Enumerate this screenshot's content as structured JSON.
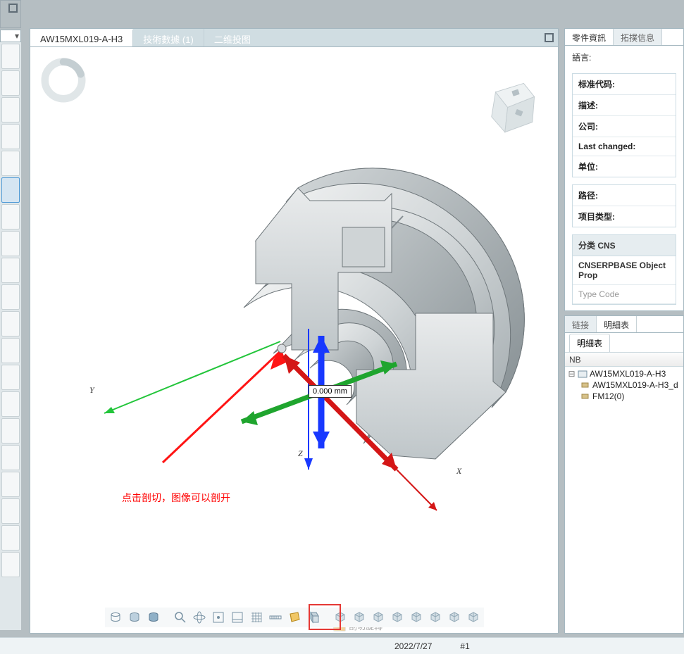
{
  "main": {
    "tabs": [
      {
        "label": "AW15MXL019-A-H3",
        "active": true
      },
      {
        "label": "技術數據 (1)",
        "active": false
      },
      {
        "label": "二维投图",
        "active": false
      }
    ],
    "measurement": "0.000 mm",
    "axes": {
      "x": "X",
      "y": "Y",
      "z": "Z"
    },
    "annotation": "点击剖切，图像可以剖开",
    "context_hint": "剖切旋轉"
  },
  "toolbar": {
    "groups": [
      [
        "cylinder-wire",
        "cylinder-solid",
        "cylinder-shaded"
      ],
      [
        "zoom-fit",
        "perspective",
        "center-view",
        "reset-view",
        "grid",
        "measure",
        "section-cut",
        "section-plane"
      ],
      [
        "iso-1",
        "iso-2",
        "iso-3",
        "iso-4",
        "iso-5",
        "iso-6",
        "iso-7",
        "iso-8"
      ]
    ],
    "active": "section-cut"
  },
  "right": {
    "info_tabs": [
      {
        "label": "零件資訊",
        "active": true
      },
      {
        "label": "拓撲信息",
        "active": false
      }
    ],
    "language_label": "語言:",
    "properties": [
      {
        "label": "标准代码:"
      },
      {
        "label": "描述:"
      },
      {
        "label": "公司:"
      },
      {
        "label": "Last changed:"
      },
      {
        "label": "单位:"
      }
    ],
    "properties2": [
      {
        "label": "路径:"
      },
      {
        "label": "项目类型:"
      }
    ],
    "class_header": "分类 CNS",
    "class_rows": [
      {
        "text": "CNSERPBASE Object Prop",
        "muted": false
      },
      {
        "text": "Type Code",
        "muted": true
      }
    ],
    "bom_tabs": [
      {
        "label": "链接",
        "active": false
      },
      {
        "label": "明細表",
        "active": true
      }
    ],
    "bom_subtab": "明細表",
    "bom_col": "NB",
    "tree": {
      "root": "AW15MXL019-A-H3",
      "children": [
        "AW15MXL019-A-H3_d",
        "FM12(0)"
      ]
    }
  },
  "status": {
    "date": "2022/7/27",
    "page": "#1"
  }
}
